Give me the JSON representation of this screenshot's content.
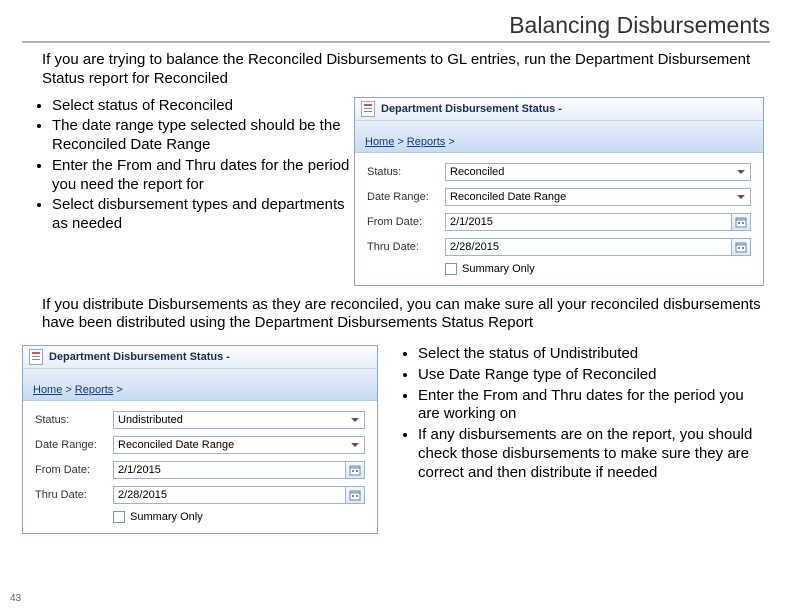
{
  "title": "Balancing Disbursements",
  "intro1": "If you are trying to balance the Reconciled Disbursements to GL entries, run the Department Disbursement Status report for Reconciled",
  "bullets1": {
    "b1": "Select status of Reconciled",
    "b2": "The date range type selected should be the Reconciled Date Range",
    "b3": "Enter the From and Thru dates for the period you need the report for",
    "b4": "Select disbursement types and departments as needed"
  },
  "intro2": "If you distribute Disbursements as they are reconciled, you can make sure all your reconciled disbursements have been distributed using the Department Disbursements Status Report",
  "bullets2": {
    "b1": "Select the status of Undistributed",
    "b2": "Use Date Range type of Reconciled",
    "b3": "Enter the From and Thru dates for the period you are working on",
    "b4": "If any disbursements are on the report, you should check those disbursements to make sure they are correct and then distribute if needed"
  },
  "pane": {
    "title": "Department Disbursement Status -",
    "crumb_home": "Home",
    "crumb_reports": "Reports",
    "labels": {
      "status": "Status:",
      "daterange": "Date Range:",
      "from": "From Date:",
      "thru": "Thru Date:",
      "summary": "Summary Only"
    },
    "values1": {
      "status": "Reconciled",
      "daterange": "Reconciled Date Range",
      "from": "2/1/2015",
      "thru": "2/28/2015"
    },
    "values2": {
      "status": "Undistributed",
      "daterange": "Reconciled Date Range",
      "from": "2/1/2015",
      "thru": "2/28/2015"
    }
  },
  "page_number": "43"
}
